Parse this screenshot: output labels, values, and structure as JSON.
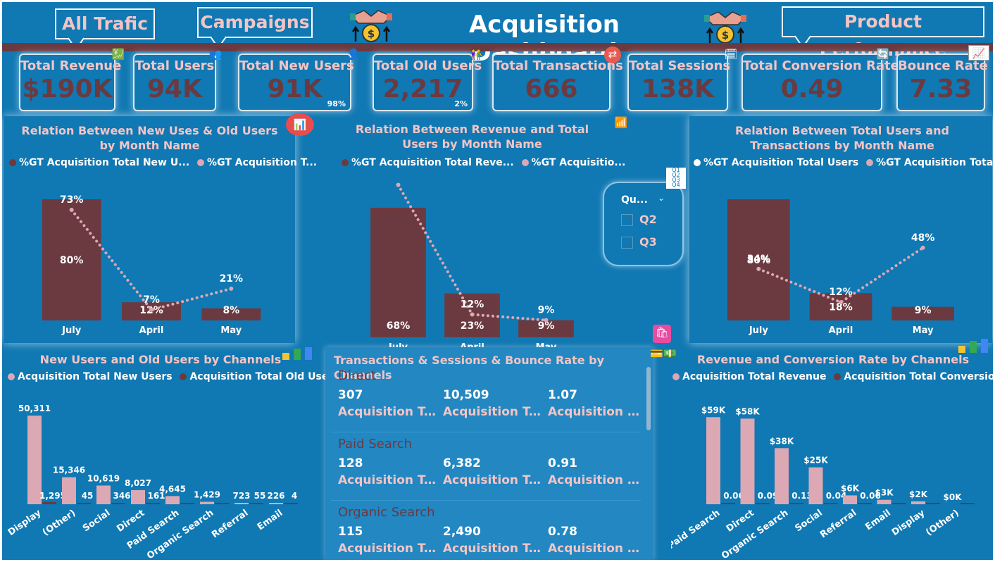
{
  "header": {
    "nav_buttons": [
      "All Trafic",
      "Campaigns",
      "Product Performance"
    ],
    "title": "Acquisition Dashboard"
  },
  "kpis": [
    {
      "label": "Total Revenue",
      "value": "$190K",
      "icon": "revenue-chart-icon"
    },
    {
      "label": "Total Users",
      "value": "94K",
      "icon": "users-group-icon"
    },
    {
      "label": "Total New Users",
      "value": "91K",
      "pct": "98%",
      "icon": "add-user-icon"
    },
    {
      "label": "Total Old Users",
      "value": "2,217",
      "pct": "2%",
      "icon": "couple-users-icon"
    },
    {
      "label": "Total Transactions",
      "value": "666",
      "icon": "transaction-icon"
    },
    {
      "label": "Total Sessions",
      "value": "138K",
      "icon": "sessions-icon"
    },
    {
      "label": "Total Conversion Rate",
      "value": "0.49",
      "icon": "conversion-icon"
    },
    {
      "label": "Bounce Rate",
      "value": "7.33",
      "icon": "bounce-chart-icon"
    }
  ],
  "colors": {
    "background": "#1078b3",
    "bar_dark": "#6b3a40",
    "pink": "#dba8b4",
    "title_pink": "#f2c5c5",
    "band": "#6b3a40"
  },
  "slicer": {
    "title": "Qu...",
    "options": [
      "Q2",
      "Q3"
    ]
  },
  "chart_data": [
    {
      "type": "bar+line",
      "title": "Relation Between New Uses & Old Users by Month Name",
      "legend": [
        "%GT Acquisition Total New U...",
        "%GT Acquisition T..."
      ],
      "categories": [
        "July",
        "April",
        "May"
      ],
      "series": [
        {
          "name": "%GT Acquisition Total New U...",
          "kind": "bar",
          "values": [
            80,
            12,
            8
          ],
          "labels": [
            "80%",
            "12%",
            "8%"
          ]
        },
        {
          "name": "%GT Acquisition T...",
          "kind": "line",
          "values": [
            73,
            7,
            21
          ],
          "labels": [
            "73%",
            "7%",
            "21%"
          ]
        }
      ],
      "ylim": [
        0,
        100
      ]
    },
    {
      "type": "bar+line",
      "title": "Relation Between Revenue and Total Users by Month Name",
      "legend": [
        "%GT Acquisition Total Reve...",
        "%GT Acquisitio..."
      ],
      "categories": [
        "July",
        "April",
        "May"
      ],
      "series": [
        {
          "name": "%GT Acquisition Total Reve...",
          "kind": "bar",
          "values": [
            68,
            23,
            9
          ],
          "labels": [
            "68%",
            "23%",
            "9%"
          ]
        },
        {
          "name": "%GT Acquisitio...",
          "kind": "line",
          "values": [
            80,
            12,
            9
          ],
          "labels": [
            "80%",
            "12%",
            "9%"
          ]
        }
      ],
      "ylim": [
        0,
        85
      ]
    },
    {
      "type": "bar+line",
      "title": "Relation Between Total Users and Transactions by Month Name",
      "legend": [
        "%GT Acquisition Total Users",
        "%GT Acquisition Total Tr..."
      ],
      "categories": [
        "July",
        "April",
        "May"
      ],
      "series": [
        {
          "name": "%GT Acquisition Total Users",
          "kind": "bar",
          "values": [
            80,
            18,
            9
          ],
          "labels": [
            "80%",
            "18%",
            "9%"
          ]
        },
        {
          "name": "%GT Acquisition Total Tr...",
          "kind": "line",
          "values": [
            34,
            12,
            48
          ],
          "labels": [
            "34%",
            "12%",
            "48%"
          ]
        }
      ],
      "ylim": [
        0,
        100
      ]
    },
    {
      "type": "bar",
      "title": "New Users and Old Users by Channels",
      "legend": [
        "Acquisition Total New Users",
        "Acquisition Total Old Users"
      ],
      "categories": [
        "Display",
        "(Other)",
        "Social",
        "Direct",
        "Paid Search",
        "Organic Search",
        "Referral",
        "Email"
      ],
      "series": [
        {
          "name": "Acquisition Total New Users",
          "values": [
            50311,
            15346,
            10619,
            8027,
            4645,
            1429,
            723,
            226
          ],
          "labels": [
            "50,311",
            "15,346",
            "10,619",
            "8,027",
            "4,645",
            "1,429",
            "723",
            "226"
          ]
        },
        {
          "name": "Acquisition Total Old Users",
          "values": [
            1295,
            45,
            346,
            161,
            0,
            0,
            55,
            4
          ],
          "labels": [
            "1,295",
            "45",
            "346",
            "161",
            "",
            "",
            "55",
            "4"
          ]
        }
      ],
      "ylim": [
        0,
        52000
      ]
    },
    {
      "type": "bar",
      "title": "Revenue and Conversion Rate by Channels",
      "legend": [
        "Acquisition Total Revenue",
        "Acquisition Total Conversion Rate"
      ],
      "categories": [
        "Paid Search",
        "Direct",
        "Organic Search",
        "Social",
        "Referral",
        "Email",
        "Display",
        "(Other)"
      ],
      "series": [
        {
          "name": "Acquisition Total Revenue",
          "values": [
            59,
            58,
            38,
            25,
            6,
            3,
            2,
            0
          ],
          "labels": [
            "$59K",
            "$58K",
            "$38K",
            "$25K",
            "$6K",
            "$3K",
            "$2K",
            "$0K"
          ]
        },
        {
          "name": "Acquisition Total Conversion Rate",
          "values": [
            0.06,
            0.09,
            0.13,
            0.04,
            0.06,
            0,
            0,
            0
          ],
          "labels": [
            "0.06",
            "0.09",
            "0.13",
            "0.04",
            "0.06",
            "",
            "",
            ""
          ]
        }
      ],
      "ylim": [
        0,
        62
      ]
    }
  ],
  "table": {
    "title": "Transactions & Sessions & Bounce Rate by Channels",
    "groups": [
      {
        "name": "Direct",
        "values": [
          "307",
          "10,509",
          "1.07"
        ],
        "labels": [
          "Acquisition T...",
          "Acquisition T...",
          "Acquisition Bou..."
        ]
      },
      {
        "name": "Paid Search",
        "values": [
          "128",
          "6,382",
          "0.91"
        ],
        "labels": [
          "Acquisition T...",
          "Acquisition T...",
          "Acquisition Bou..."
        ]
      },
      {
        "name": "Organic Search",
        "values": [
          "115",
          "2,490",
          "0.78"
        ],
        "labels": [
          "Acquisition T...",
          "Acquisition T...",
          "Acquisition Bou..."
        ]
      }
    ]
  }
}
